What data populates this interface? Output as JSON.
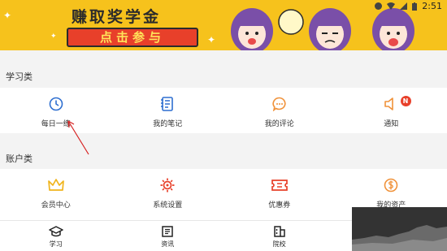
{
  "status_bar": {
    "time": "2:51"
  },
  "banner": {
    "title": "赚取奖学金",
    "button": "点击参与"
  },
  "study_section": {
    "label": "学习类",
    "items": [
      {
        "label": "每日一练",
        "icon": "clock-icon",
        "color": "#2f6fd0"
      },
      {
        "label": "我的笔记",
        "icon": "notebook-icon",
        "color": "#2f6fd0"
      },
      {
        "label": "我的评论",
        "icon": "comment-icon",
        "color": "#f0923a"
      },
      {
        "label": "通知",
        "icon": "speaker-icon",
        "color": "#f0923a",
        "badge": "N"
      }
    ]
  },
  "account_section": {
    "label": "账户类",
    "items": [
      {
        "label": "会员中心",
        "icon": "crown-icon",
        "color": "#f0b41c"
      },
      {
        "label": "系统设置",
        "icon": "gear-icon",
        "color": "#e8402a"
      },
      {
        "label": "优惠券",
        "icon": "coupon-icon",
        "color": "#e8402a"
      },
      {
        "label": "我的资产",
        "icon": "coin-icon",
        "color": "#f0923a"
      }
    ]
  },
  "bottom_nav": [
    {
      "label": "学习",
      "icon": "graduation-cap-icon"
    },
    {
      "label": "资讯",
      "icon": "news-icon"
    },
    {
      "label": "院校",
      "icon": "building-icon"
    }
  ]
}
